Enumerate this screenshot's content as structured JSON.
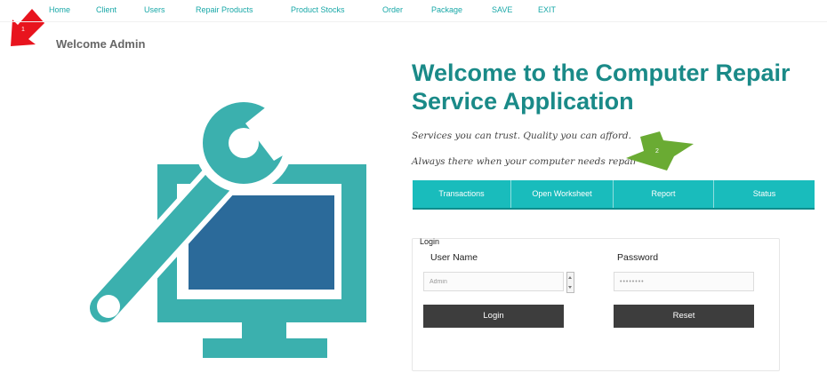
{
  "nav": {
    "items": [
      {
        "label": "Home"
      },
      {
        "label": "Client"
      },
      {
        "label": "Users"
      },
      {
        "label": "Repair Products"
      },
      {
        "label": "Product Stocks"
      },
      {
        "label": "Order"
      },
      {
        "label": "Package"
      },
      {
        "label": "SAVE"
      },
      {
        "label": "EXIT"
      }
    ]
  },
  "welcome_admin": "Welcome Admin",
  "main": {
    "title": "Welcome to the Computer Repair Service Application",
    "taglines": [
      "Services you can trust. Quality you can afford.",
      "Always there when your computer needs repair"
    ],
    "buttons": [
      "Transactions",
      "Open Worksheet",
      "Report",
      "Status"
    ]
  },
  "login": {
    "title": "Login",
    "username_label": "User Name",
    "username_value": "Admin",
    "password_label": "Password",
    "password_value": "••••••••",
    "login_button": "Login",
    "reset_button": "Reset"
  },
  "markers": [
    "1",
    "2"
  ],
  "colors": {
    "accent": "#19bcbc",
    "title": "#1a8a88",
    "logo": "#3bb0ae",
    "screen": "#2b6a9a",
    "dark_button": "#3d3d3d",
    "marker_1": "#e8141e",
    "marker_2": "#6aab33"
  },
  "icons": [
    "repair-logo-icon"
  ]
}
